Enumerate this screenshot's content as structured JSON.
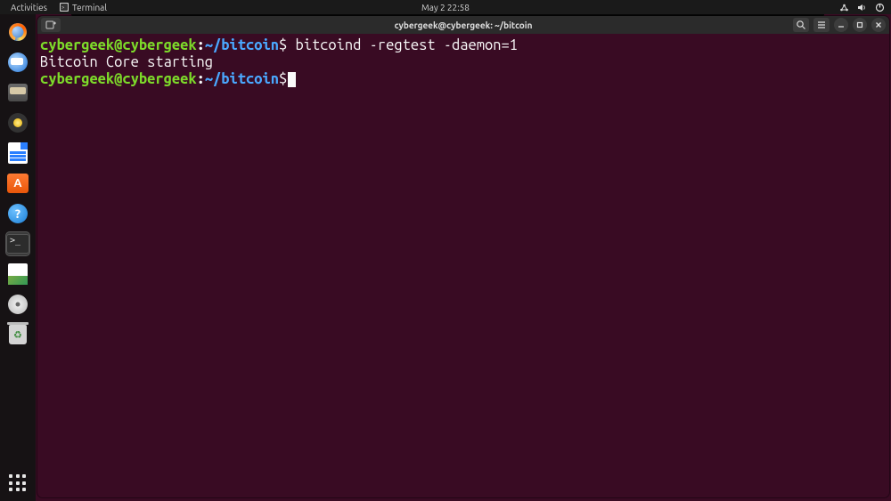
{
  "topbar": {
    "activities": "Activities",
    "app_label": "Terminal",
    "clock": "May 2  22:58"
  },
  "dock": {
    "items": [
      {
        "name": "firefox-icon"
      },
      {
        "name": "thunderbird-icon"
      },
      {
        "name": "files-icon"
      },
      {
        "name": "rhythmbox-icon"
      },
      {
        "name": "libreoffice-writer-icon"
      },
      {
        "name": "ubuntu-software-icon"
      },
      {
        "name": "help-icon"
      },
      {
        "name": "terminal-icon"
      },
      {
        "name": "text-editor-icon"
      },
      {
        "name": "disk-icon"
      },
      {
        "name": "trash-icon"
      }
    ]
  },
  "terminal": {
    "window_title": "cybergeek@cybergeek: ~/bitcoin",
    "prompt_user_host": "cybergeek@cybergeek",
    "prompt_sep": ":",
    "prompt_path": "~/bitcoin",
    "prompt_symbol": "$",
    "lines": {
      "l1_cmd": " bitcoind -regtest -daemon=1",
      "l2_out": "Bitcoin Core starting"
    }
  }
}
